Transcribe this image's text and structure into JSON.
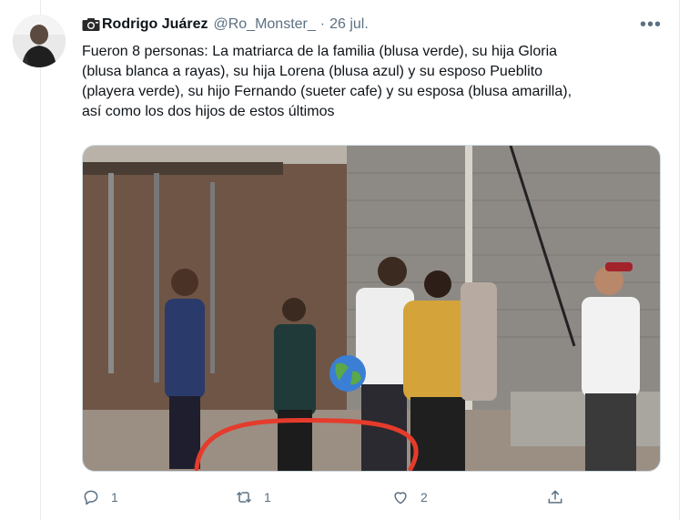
{
  "tweet": {
    "author_name": "Rodrigo Juárez",
    "handle": "@Ro_Monster_",
    "separator": "·",
    "date": "26 jul.",
    "more_label": "•••",
    "text": "Fueron 8 personas: La matriarca de la familia (blusa verde), su hija Gloria\n(blusa blanca a rayas), su hija Lorena (blusa azul) y su esposo Pueblito\n(playera verde), su hijo Fernando (sueter cafe) y su esposa (blusa amarilla),\nasí como los dos hijos de estos últimos"
  },
  "icons": {
    "name_prefix": "camera-icon",
    "avatar": "avatar-photo",
    "overlay": "globe-emoji"
  },
  "actions": {
    "reply_count": "1",
    "retweet_count": "1",
    "like_count": "2"
  },
  "colors": {
    "text_primary": "#0f1419",
    "text_secondary": "#5b7083",
    "border": "#cfd9de",
    "scribble": "#e53b2c"
  }
}
